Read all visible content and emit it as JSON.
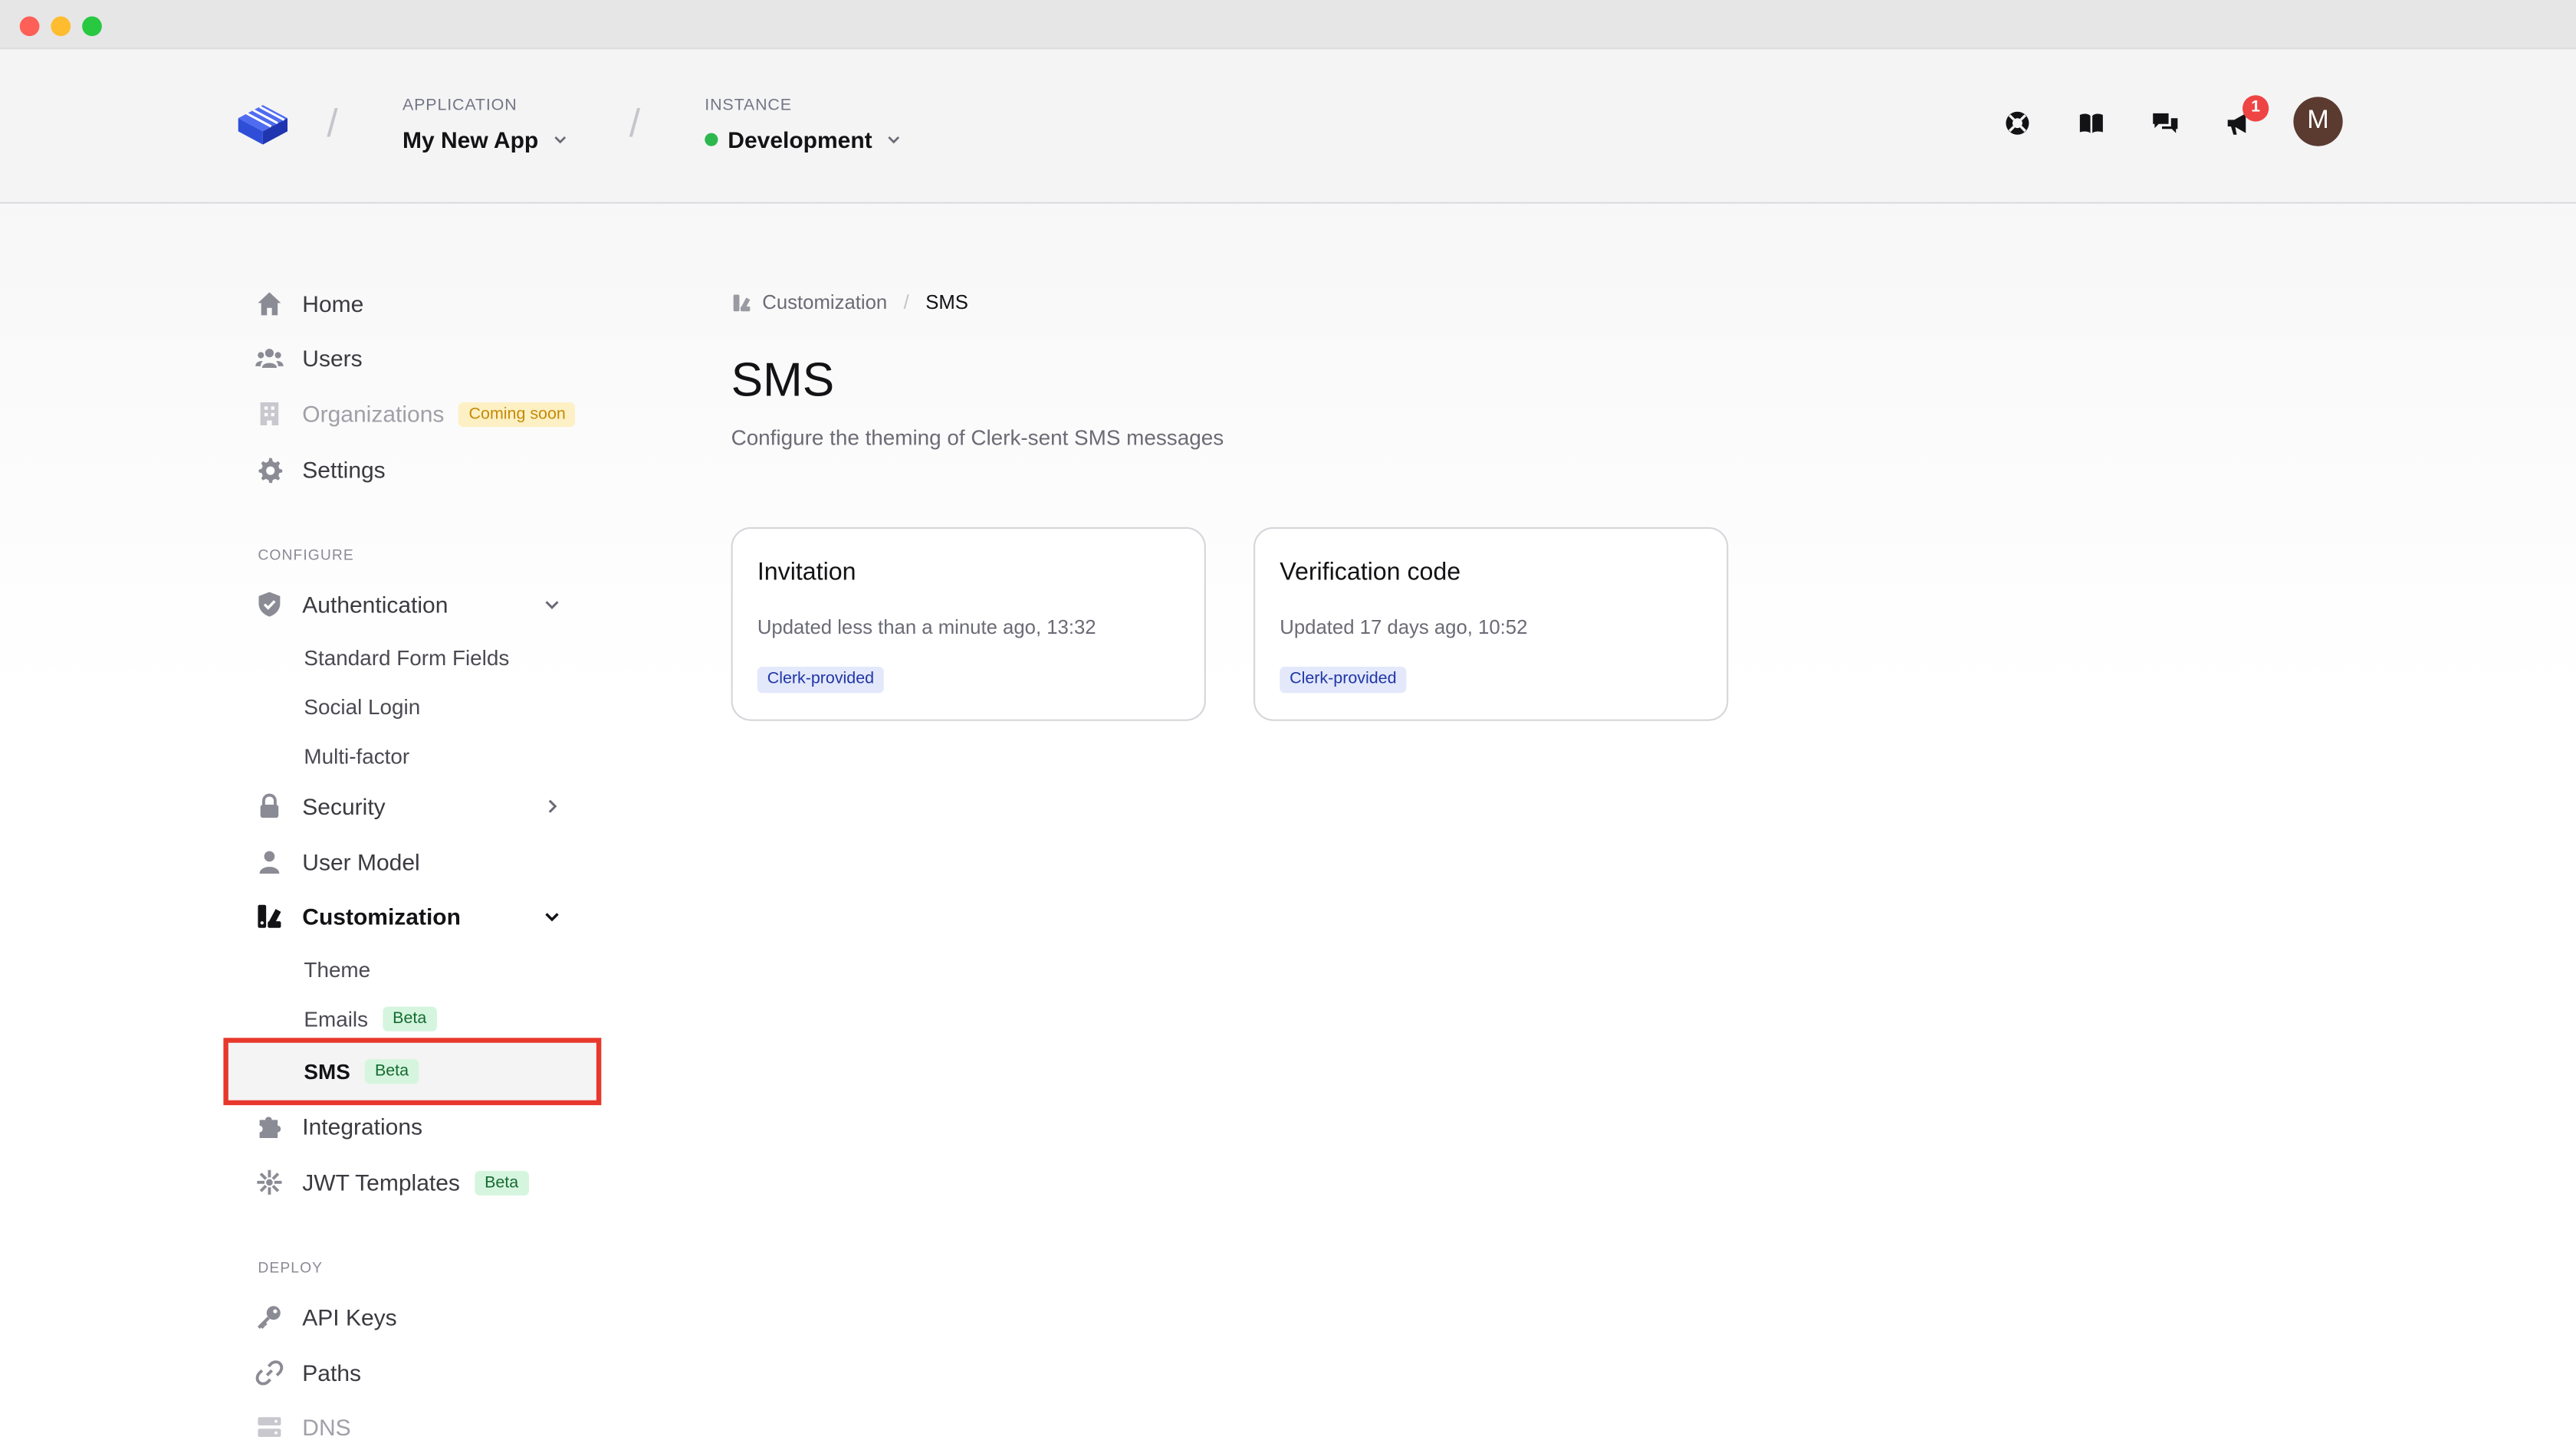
{
  "header": {
    "application_caption": "APPLICATION",
    "application_name": "My New App",
    "instance_caption": "INSTANCE",
    "instance_name": "Development",
    "notification_count": "1",
    "avatar_initial": "M",
    "icons": [
      "help-lifebuoy-icon",
      "docs-book-icon",
      "feedback-chat-icon",
      "announcements-megaphone-icon"
    ]
  },
  "sidebar": {
    "home": "Home",
    "users": "Users",
    "organizations": "Organizations",
    "organizations_badge": "Coming soon",
    "settings": "Settings",
    "configure_caption": "CONFIGURE",
    "authentication": "Authentication",
    "auth_sub": [
      "Standard Form Fields",
      "Social Login",
      "Multi-factor"
    ],
    "security": "Security",
    "user_model": "User Model",
    "customization": "Customization",
    "custom_sub": {
      "theme": "Theme",
      "emails": "Emails",
      "emails_badge": "Beta",
      "sms": "SMS",
      "sms_badge": "Beta"
    },
    "integrations": "Integrations",
    "jwt_templates": "JWT Templates",
    "jwt_badge": "Beta",
    "deploy_caption": "DEPLOY",
    "api_keys": "API Keys",
    "paths": "Paths",
    "dns": "DNS"
  },
  "breadcrumb": {
    "parent": "Customization",
    "separator": "/",
    "current": "SMS"
  },
  "main": {
    "title": "SMS",
    "subtitle": "Configure the theming of Clerk-sent SMS messages",
    "cards": [
      {
        "title": "Invitation",
        "updated": "Updated less than a minute ago, 13:32",
        "badge": "Clerk-provided"
      },
      {
        "title": "Verification code",
        "updated": "Updated 17 days ago, 10:52",
        "badge": "Clerk-provided"
      }
    ]
  },
  "colors": {
    "accent": "#2f4ed8",
    "highlight_border": "#e8382d",
    "instance_status": "#2db84d",
    "beta_badge_bg": "#d6f5df",
    "soon_badge_bg": "#fdf0c4"
  }
}
